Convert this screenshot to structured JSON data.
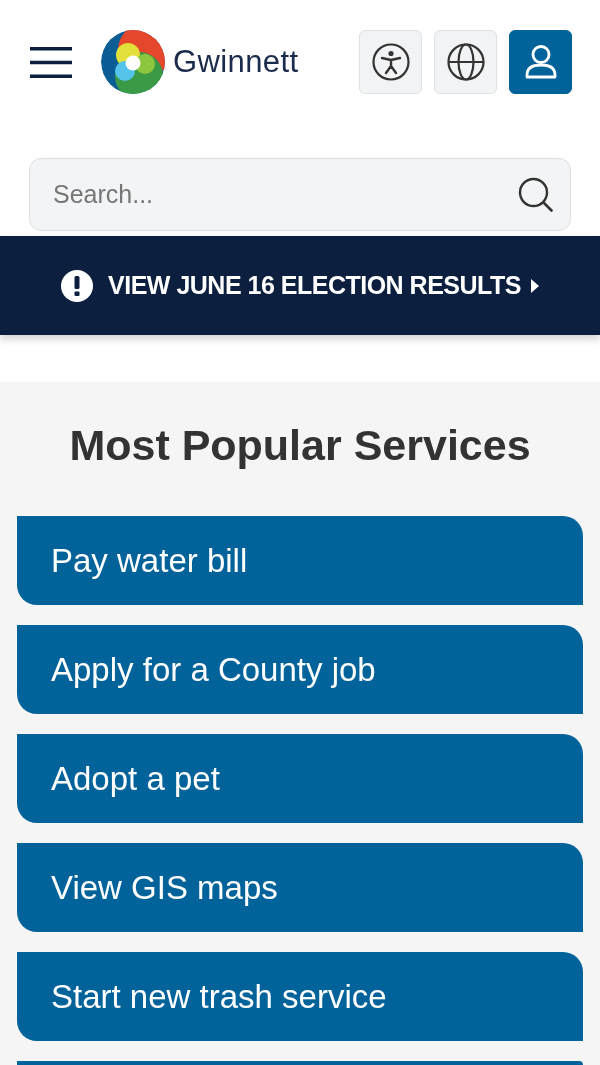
{
  "header": {
    "logo_text": "Gwinnett",
    "buttons": [
      {
        "kind": "accessibility"
      },
      {
        "kind": "language"
      },
      {
        "kind": "account"
      }
    ]
  },
  "search": {
    "placeholder": "Search..."
  },
  "alert_banner": {
    "text": "VIEW JUNE 16 ELECTION RESULTS"
  },
  "popular_services": {
    "title": "Most Popular Services",
    "items": [
      {
        "label": "Pay water bill"
      },
      {
        "label": "Apply for a County job"
      },
      {
        "label": "Adopt a pet"
      },
      {
        "label": "View GIS maps"
      },
      {
        "label": "Start new trash service"
      }
    ],
    "more_below": true
  }
}
